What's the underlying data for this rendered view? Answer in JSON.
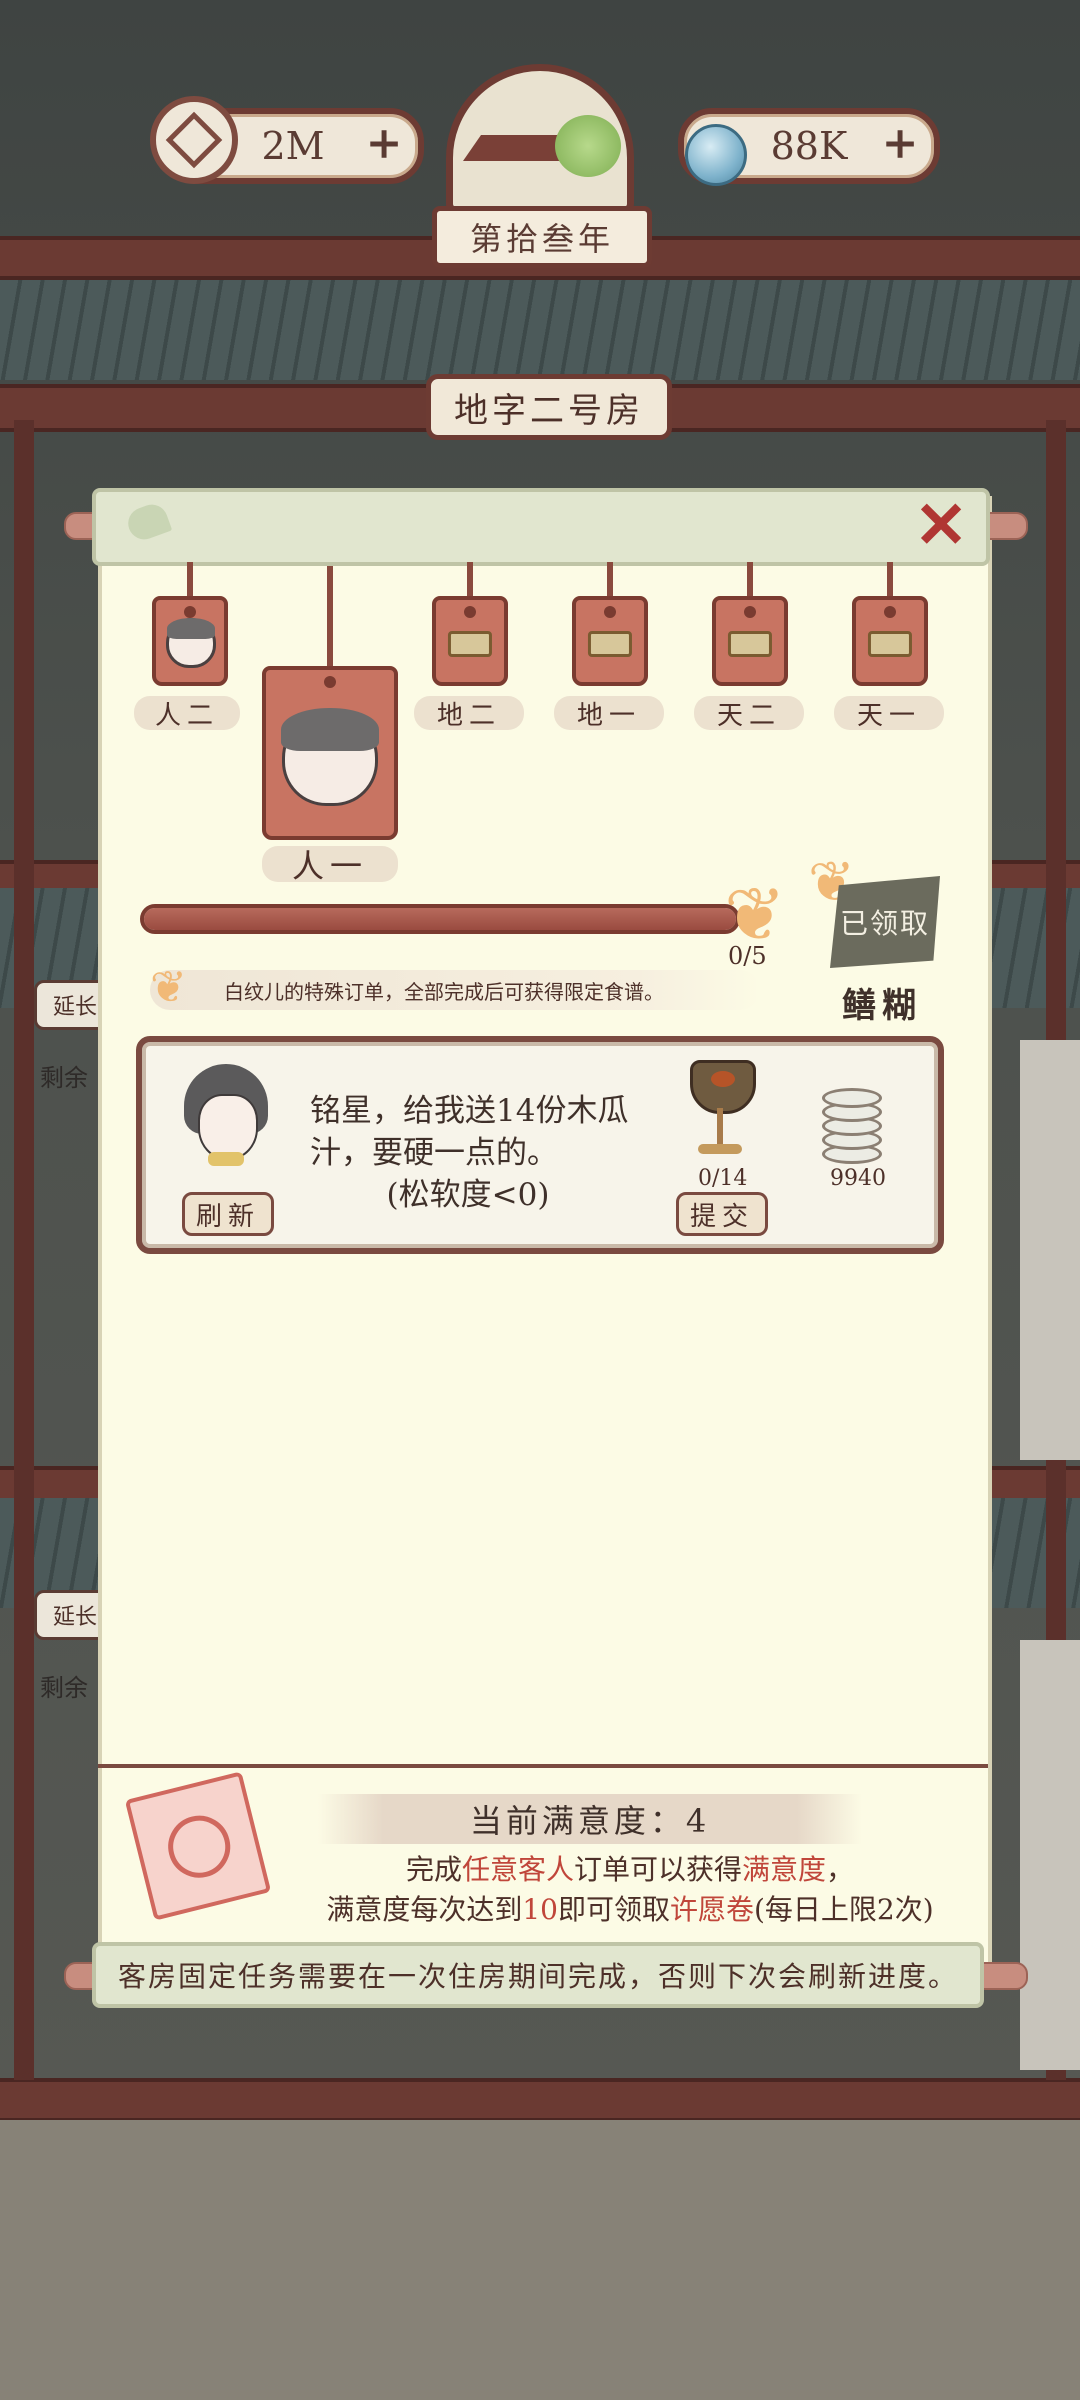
{
  "hud": {
    "coins": "2M",
    "water": "88K",
    "year": "第拾叁年",
    "room": "地字二号房",
    "side_sign_1": "延长",
    "side_text_1": "剩余",
    "side_sign_2": "延长",
    "side_text_2": "剩余"
  },
  "tags": [
    {
      "label": "人二",
      "state": "guest"
    },
    {
      "label": "人一",
      "state": "selected-guest"
    },
    {
      "label": "地二",
      "state": "empty"
    },
    {
      "label": "地一",
      "state": "empty"
    },
    {
      "label": "天二",
      "state": "empty"
    },
    {
      "label": "天一",
      "state": "empty"
    }
  ],
  "progress": {
    "count": "0/5",
    "value": 0,
    "max": 5,
    "claim_label": "已领取",
    "reward_name": "鳝糊",
    "hint": "白纹儿的特殊订单，全部完成后可获得限定食谱。"
  },
  "order": {
    "text": "铭星，给我送14份木瓜汁，要硬一点的。",
    "condition": "(松软度<0)",
    "refresh_label": "刷新",
    "submit_label": "提交",
    "item_count": "0/14",
    "reward_amount": "9940"
  },
  "satisfaction": {
    "title": "当前满意度：4",
    "line1_a": "完成",
    "line1_b": "任意客人",
    "line1_c": "订单可以获得",
    "line1_d": "满意度",
    "line1_e": "，",
    "line2_a": "满意度每次达到",
    "line2_b": "10",
    "line2_c": "即可领取",
    "line2_d": "许愿卷",
    "line2_e": "(每日上限2次)"
  },
  "notice": "客房固定任务需要在一次住房期间完成，否则下次会刷新进度。",
  "colors": {
    "accent_red": "#c0463a",
    "wood": "#7a3b30",
    "panel": "#fcfbe5"
  }
}
